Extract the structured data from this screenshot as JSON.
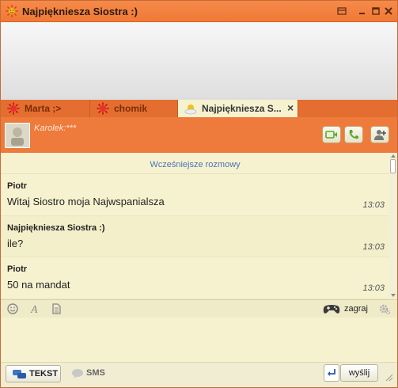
{
  "window": {
    "title": "Najpiękniesza Siostra :)"
  },
  "tabs": [
    {
      "label": "Marta ;>"
    },
    {
      "label": "chomik"
    },
    {
      "label": "Najpiękniesza S...",
      "close": "×"
    }
  ],
  "contact": {
    "description": "Karolek:***"
  },
  "chat": {
    "earlier_link": "Wcześniejsze rozmowy",
    "messages": [
      {
        "sender": "Piotr",
        "text": "Witaj Siostro moja Najwspanialsza",
        "time": "13:03"
      },
      {
        "sender": "Najpiękniesza Siostra :)",
        "text": "ile?",
        "time": "13:03"
      },
      {
        "sender": "Piotr",
        "text": "50 na mandat",
        "time": "13:03"
      }
    ]
  },
  "toolbar": {
    "game_label": "zagraj"
  },
  "bottom": {
    "mode_text": "TEKST",
    "mode_sms": "SMS",
    "send_label": "wyślij"
  },
  "colors": {
    "accent_orange": "#ef7a36",
    "chat_background": "#f6f2d0",
    "link_blue": "#4a74b4",
    "call_green": "#5aa832"
  }
}
